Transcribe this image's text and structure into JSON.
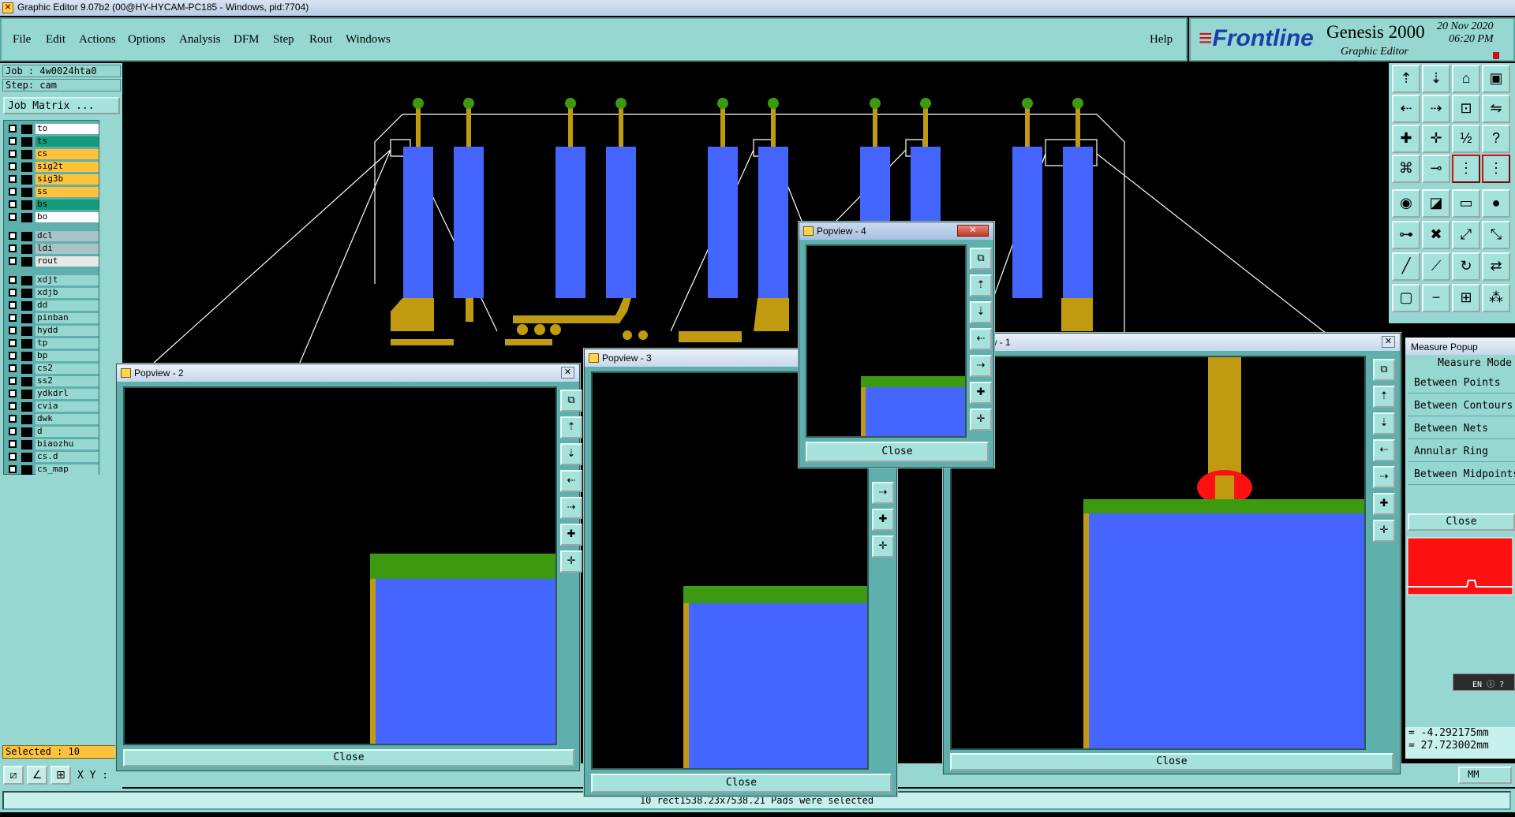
{
  "window": {
    "title": "Graphic Editor 9.07b2 (00@HY-HYCAM-PC185 - Windows, pid:7704)"
  },
  "menu": {
    "file": "File",
    "edit": "Edit",
    "actions": "Actions",
    "options": "Options",
    "analysis": "Analysis",
    "dfm": "DFM",
    "step": "Step",
    "rout": "Rout",
    "windows": "Windows",
    "help": "Help"
  },
  "brand": {
    "logo": "Frontline",
    "product": "Genesis 2000",
    "subtitle": "Graphic Editor",
    "date": "20 Nov 2020",
    "time": "06:20 PM"
  },
  "job": {
    "job": "Job : 4w0024hta0",
    "step": "Step: cam",
    "matrix": "Job Matrix ..."
  },
  "layers": [
    {
      "name": "to",
      "color": "#ffffff"
    },
    {
      "name": "ts",
      "color": "#169a7c"
    },
    {
      "name": "cs",
      "color": "#ffc23b"
    },
    {
      "name": "sig2t",
      "color": "#ffc23b"
    },
    {
      "name": "sig3b",
      "color": "#ffc23b"
    },
    {
      "name": "ss",
      "color": "#ffc23b"
    },
    {
      "name": "bs",
      "color": "#169a7c"
    },
    {
      "name": "bo",
      "color": "#ffffff"
    },
    {
      "name": "dcl",
      "color": "#a9c4c9"
    },
    {
      "name": "ldi",
      "color": "#a9c4c9"
    },
    {
      "name": "rout",
      "color": "#e8e8e8"
    },
    {
      "name": "xdjt",
      "color": "#96d7d2"
    },
    {
      "name": "xdjb",
      "color": "#96d7d2"
    },
    {
      "name": "dd",
      "color": "#96d7d2"
    },
    {
      "name": "pinban",
      "color": "#96d7d2"
    },
    {
      "name": "hydd",
      "color": "#96d7d2"
    },
    {
      "name": "tp",
      "color": "#96d7d2"
    },
    {
      "name": "bp",
      "color": "#96d7d2"
    },
    {
      "name": "cs2",
      "color": "#96d7d2"
    },
    {
      "name": "ss2",
      "color": "#96d7d2"
    },
    {
      "name": "ydkdrl",
      "color": "#96d7d2"
    },
    {
      "name": "cvia",
      "color": "#96d7d2"
    },
    {
      "name": "dwk",
      "color": "#96d7d2"
    },
    {
      "name": "d",
      "color": "#96d7d2"
    },
    {
      "name": "biaozhu",
      "color": "#96d7d2"
    },
    {
      "name": "cs.d",
      "color": "#96d7d2"
    },
    {
      "name": "cs_map",
      "color": "#96d7d2"
    }
  ],
  "status": {
    "selected": "Selected : 10",
    "xy_label": "X Y :",
    "message": "10 rect1538.23x7538.21 Pads were selected",
    "units": "MM"
  },
  "popviews": {
    "p1": {
      "title": "Popview - 1",
      "close": "Close"
    },
    "p2": {
      "title": "Popview - 2",
      "close": "Close"
    },
    "p3": {
      "title": "Popview - 3",
      "close": "Close"
    },
    "p4": {
      "title": "Popview - 4",
      "close": "Close"
    }
  },
  "measure": {
    "title": "Measure Popup",
    "mode": "Measure Mode",
    "options": [
      "Between Points",
      "Between Contours",
      "Between Nets",
      "Annular Ring",
      "Between Midpoints"
    ],
    "close": "Close",
    "dx": "= -4.292175mm",
    "dy": "= 27.723002mm"
  },
  "ime": {
    "label": "EN"
  },
  "colors": {
    "panel": "#96d7d2",
    "pad_blue": "#4466ff",
    "copper_gold": "#c09a10",
    "mask_green": "#3d9a10",
    "highlight_red": "#ff1010"
  }
}
